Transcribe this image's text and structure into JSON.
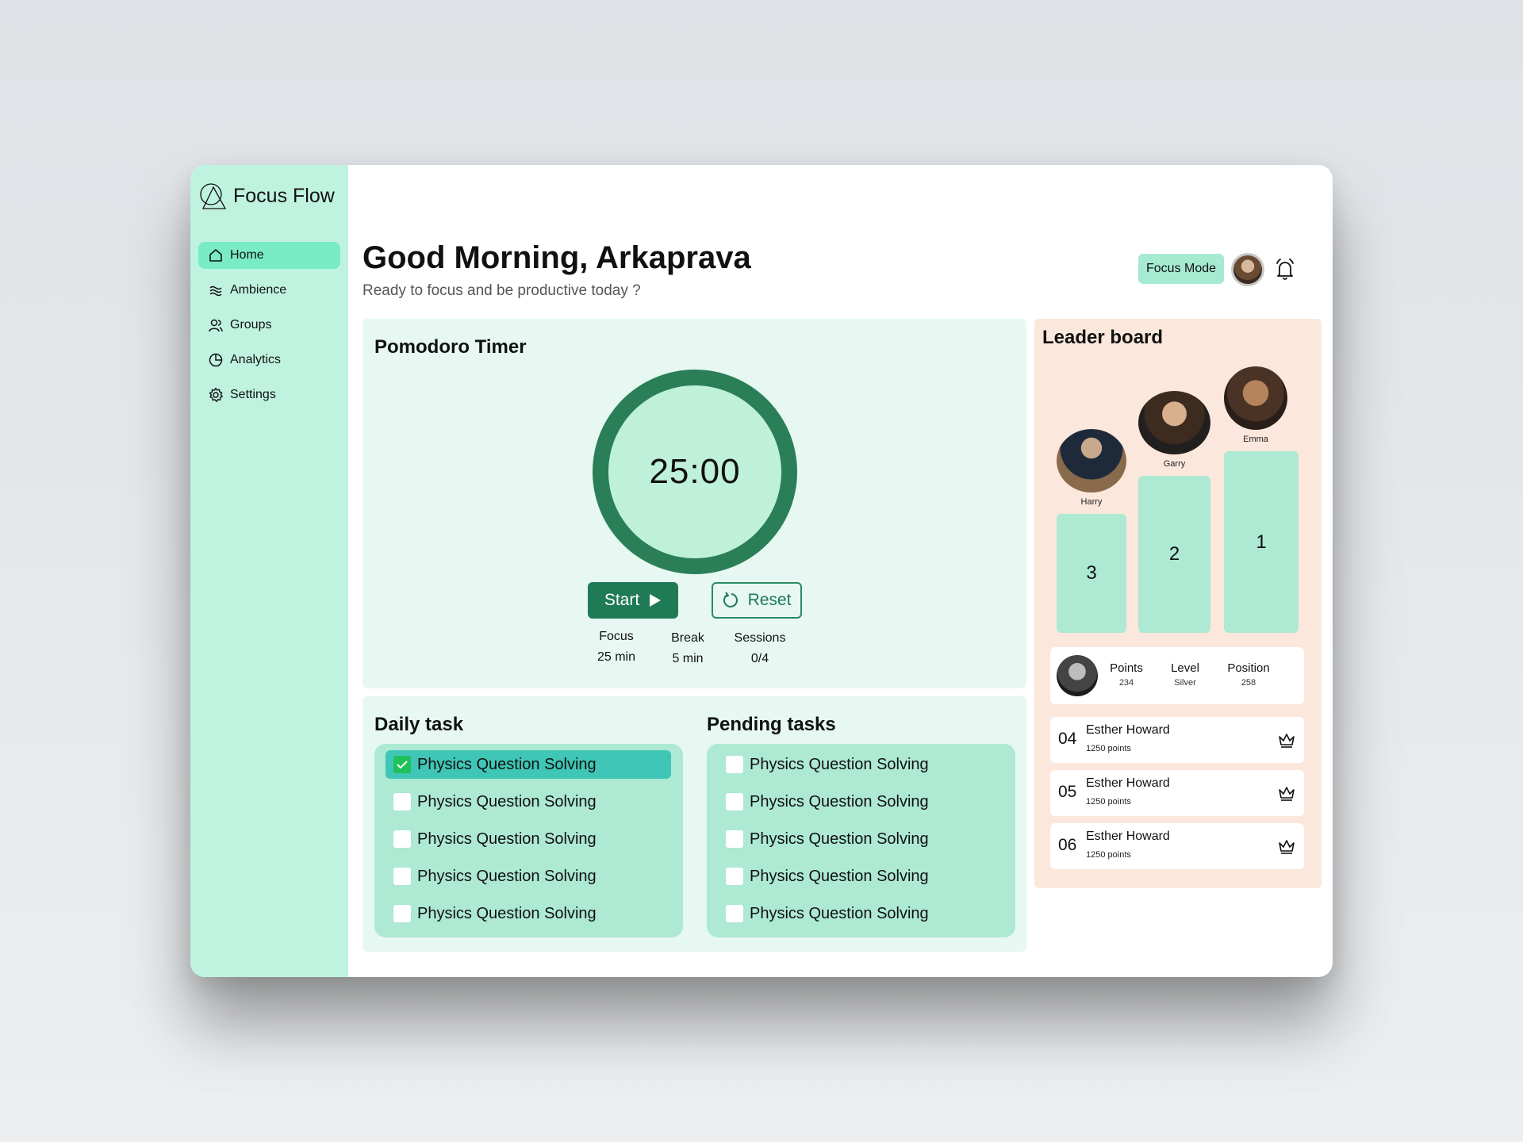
{
  "app": {
    "name": "Focus Flow"
  },
  "sidebar": {
    "items": [
      {
        "label": "Home",
        "icon": "home-icon",
        "active": true
      },
      {
        "label": "Ambience",
        "icon": "waves-icon"
      },
      {
        "label": "Groups",
        "icon": "users-icon"
      },
      {
        "label": "Analytics",
        "icon": "pie-chart-icon"
      },
      {
        "label": "Settings",
        "icon": "gear-icon"
      }
    ]
  },
  "header": {
    "greeting": "Good Morning, Arkaprava",
    "subtitle": "Ready to focus and be productive today ?",
    "focus_mode_label": "Focus Mode"
  },
  "pomodoro": {
    "title": "Pomodoro Timer",
    "time": "25:00",
    "start_label": "Start",
    "reset_label": "Reset",
    "stats": [
      {
        "label": "Focus",
        "value": "25 min"
      },
      {
        "label": "Break",
        "value": "5 min"
      },
      {
        "label": "Sessions",
        "value": "0/4"
      }
    ]
  },
  "daily_tasks": {
    "title": "Daily task",
    "items": [
      {
        "label": "Physics Question Solving",
        "checked": true
      },
      {
        "label": "Physics Question Solving",
        "checked": false
      },
      {
        "label": "Physics Question Solving",
        "checked": false
      },
      {
        "label": "Physics Question Solving",
        "checked": false
      },
      {
        "label": "Physics Question Solving",
        "checked": false
      }
    ]
  },
  "pending_tasks": {
    "title": "Pending tasks",
    "items": [
      {
        "label": "Physics Question Solving",
        "checked": false
      },
      {
        "label": "Physics Question Solving",
        "checked": false
      },
      {
        "label": "Physics Question Solving",
        "checked": false
      },
      {
        "label": "Physics Question Solving",
        "checked": false
      },
      {
        "label": "Physics Question Solving",
        "checked": false
      }
    ]
  },
  "leaderboard": {
    "title": "Leader board",
    "podium": [
      {
        "name": "Harry",
        "rank": "3"
      },
      {
        "name": "Garry",
        "rank": "2"
      },
      {
        "name": "Emma",
        "rank": "1"
      }
    ],
    "me": {
      "stats": [
        {
          "label": "Points",
          "value": "234"
        },
        {
          "label": "Level",
          "value": "Silver"
        },
        {
          "label": "Position",
          "value": "258"
        }
      ]
    },
    "rows": [
      {
        "rank": "04",
        "name": "Esther Howard",
        "points": "1250 points"
      },
      {
        "rank": "05",
        "name": "Esther Howard",
        "points": "1250 points"
      },
      {
        "rank": "06",
        "name": "Esther Howard",
        "points": "1250 points"
      }
    ]
  },
  "colors": {
    "sidebar_bg": "#bff3df",
    "active_nav": "#79ecc6",
    "accent_dark_green": "#1f7a56",
    "card_bg": "#e6f8f1",
    "leaderboard_bg": "#fce7dc",
    "podium": "#ade9d3"
  }
}
